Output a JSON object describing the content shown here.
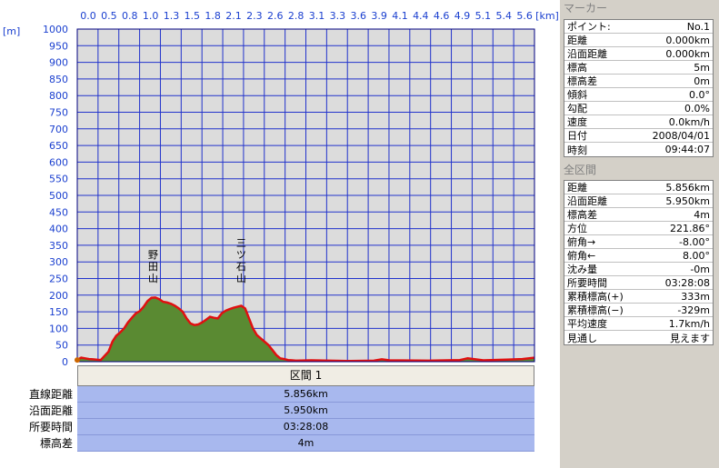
{
  "chart_data": {
    "type": "area",
    "x_unit_label": "[km]",
    "y_unit_label": "[m]",
    "xlim": [
      0,
      5.856
    ],
    "ylim": [
      0,
      1000
    ],
    "x_ticks": [
      "0.0",
      "0.5",
      "0.8",
      "1.0",
      "1.3",
      "1.5",
      "1.8",
      "2.1",
      "2.3",
      "2.6",
      "2.8",
      "3.1",
      "3.3",
      "3.6",
      "3.9",
      "4.1",
      "4.4",
      "4.6",
      "4.9",
      "5.1",
      "5.4",
      "5.6"
    ],
    "y_ticks": [
      "1000",
      "950",
      "900",
      "850",
      "800",
      "750",
      "700",
      "650",
      "600",
      "550",
      "500",
      "450",
      "400",
      "350",
      "300",
      "250",
      "200",
      "150",
      "100",
      "50",
      "0"
    ],
    "series": [
      {
        "x": [
          0,
          0.05,
          0.1,
          0.15,
          0.2,
          0.3,
          0.4,
          0.45,
          0.5,
          0.55,
          0.6,
          0.65,
          0.7,
          0.75,
          0.8,
          0.85,
          0.9,
          0.95,
          1.0,
          1.05,
          1.1,
          1.15,
          1.2,
          1.25,
          1.3,
          1.35,
          1.4,
          1.45,
          1.5,
          1.55,
          1.6,
          1.65,
          1.7,
          1.75,
          1.8,
          1.85,
          1.9,
          1.95,
          2.0,
          2.05,
          2.1,
          2.15,
          2.2,
          2.25,
          2.3,
          2.35,
          2.4,
          2.45,
          2.5,
          2.55,
          2.6,
          2.65,
          2.7,
          2.75,
          2.8,
          3.0,
          3.5,
          3.8,
          3.9,
          4.0,
          4.5,
          4.9,
          5.0,
          5.2,
          5.5,
          5.7,
          5.856
        ],
        "y": [
          5,
          12,
          10,
          8,
          7,
          5,
          30,
          60,
          78,
          88,
          100,
          118,
          132,
          145,
          152,
          165,
          182,
          192,
          193,
          188,
          180,
          178,
          174,
          168,
          160,
          150,
          130,
          115,
          110,
          112,
          118,
          126,
          135,
          132,
          130,
          145,
          153,
          158,
          162,
          165,
          168,
          160,
          130,
          100,
          80,
          70,
          60,
          50,
          35,
          20,
          10,
          8,
          5,
          4,
          3,
          4,
          2,
          3,
          7,
          4,
          3,
          5,
          10,
          4,
          6,
          8,
          12
        ]
      }
    ],
    "annotations": [
      {
        "text": "野田山",
        "x": 0.97
      },
      {
        "text": "三ツ石山",
        "x": 2.1
      }
    ]
  },
  "marker_panel": {
    "title": "マーカー",
    "rows": [
      {
        "label": "ポイント:",
        "value": "No.1"
      },
      {
        "label": "距離",
        "value": "0.000km"
      },
      {
        "label": "沿面距離",
        "value": "0.000km"
      },
      {
        "label": "標高",
        "value": "5m"
      },
      {
        "label": "標高差",
        "value": "0m"
      },
      {
        "label": "傾斜",
        "value": "0.0°"
      },
      {
        "label": "勾配",
        "value": "0.0%"
      },
      {
        "label": "速度",
        "value": "0.0km/h"
      },
      {
        "label": "日付",
        "value": "2008/04/01"
      },
      {
        "label": "時刻",
        "value": "09:44:07"
      }
    ]
  },
  "section_panel": {
    "title": "全区間",
    "rows": [
      {
        "label": "距離",
        "value": "5.856km"
      },
      {
        "label": "沿面距離",
        "value": "5.950km"
      },
      {
        "label": "標高差",
        "value": "4m"
      },
      {
        "label": "方位",
        "value": "221.86°"
      },
      {
        "label": "俯角→",
        "value": "-8.00°"
      },
      {
        "label": "俯角←",
        "value": "8.00°"
      },
      {
        "label": "沈み量",
        "value": "-0m"
      },
      {
        "label": "所要時間",
        "value": "03:28:08"
      },
      {
        "label": "累積標高(+)",
        "value": "333m"
      },
      {
        "label": "累積標高(−)",
        "value": "-329m"
      },
      {
        "label": "平均速度",
        "value": "1.7km/h"
      },
      {
        "label": "見通し",
        "value": "見えます"
      }
    ]
  },
  "segment_tab": {
    "label": "区間 1"
  },
  "bottom_table": {
    "rows": [
      {
        "label": "直線距離",
        "value": "5.856km"
      },
      {
        "label": "沿面距離",
        "value": "5.950km"
      },
      {
        "label": "所要時間",
        "value": "03:28:08"
      },
      {
        "label": "標高差",
        "value": "4m"
      }
    ]
  },
  "colors": {
    "plot_bg": "#dcdcdc",
    "grid": "#2233cc",
    "fill": "#5a8a32",
    "line": "#e01010",
    "tick_text": "#1a3fcf",
    "table_bg": "#a8b8ee"
  }
}
